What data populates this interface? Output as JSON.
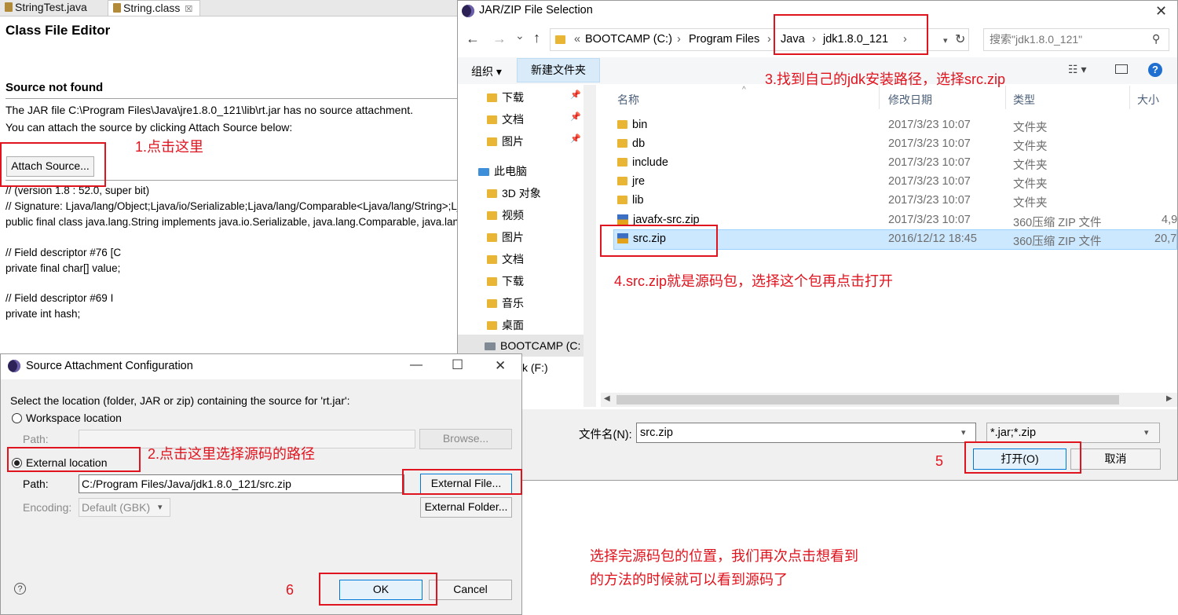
{
  "editor": {
    "tabs": [
      {
        "label": "StringTest.java"
      },
      {
        "label": "String.class",
        "close": "☒"
      }
    ],
    "title": "Class File Editor",
    "source_header": "Source not found",
    "line1": "The JAR file C:\\Program Files\\Java\\jre1.8.0_121\\lib\\rt.jar has no source attachment.",
    "line2": "You can attach the source by clicking Attach Source below:",
    "attach_button": "Attach Source...",
    "code": [
      "//  (version 1.8 : 52.0, super bit)",
      "// Signature: Ljava/lang/Object;Ljava/io/Serializable;Ljava/lang/Comparable<Ljava/lang/String>;Ljava/lang/CharSequence;",
      "public final class java.lang.String implements java.io.Serializable, java.lang.Comparable, java.lang.CharSequence {",
      "",
      "  // Field descriptor #76 [C",
      "  private final char[] value;",
      "",
      "  // Field descriptor #69 I",
      "  private int hash;"
    ]
  },
  "sac": {
    "title": "Source Attachment Configuration",
    "minimize": "—",
    "maximize": "☐",
    "close": "✕",
    "prompt": "Select the location (folder, JAR or zip) containing the source for 'rt.jar':",
    "workspace_label": "Workspace location",
    "path_label": "Path:",
    "browse_button": "Browse...",
    "external_label": "External location",
    "path_value": "C:/Program Files/Java/jdk1.8.0_121/src.zip",
    "external_file_button": "External File...",
    "encoding_label": "Encoding:",
    "encoding_value": "Default (GBK)",
    "external_folder_button": "External Folder...",
    "help": "?",
    "ok_button": "OK",
    "cancel_button": "Cancel"
  },
  "jar": {
    "title": "JAR/ZIP File Selection",
    "close": "✕",
    "back": "←",
    "forward": "→",
    "recent": "⌄",
    "up": "↑",
    "breadcrumb": [
      "«",
      "BOOTCAMP (C:)",
      "›",
      "Program Files",
      "›",
      "Java",
      "›",
      "jdk1.8.0_121",
      "›"
    ],
    "refresh": "↻",
    "search_placeholder": "搜索\"jdk1.8.0_121\"",
    "organize": "组织 ▾",
    "new_folder": "新建文件夹",
    "nav": [
      {
        "label": "下载",
        "kind": "folder",
        "pin": "📌"
      },
      {
        "label": "文档",
        "kind": "folder",
        "pin": "📌"
      },
      {
        "label": "图片",
        "kind": "folder",
        "pin": "📌"
      },
      {
        "label": "此电脑",
        "kind": "pc"
      },
      {
        "label": "3D 对象",
        "kind": "folder"
      },
      {
        "label": "视频",
        "kind": "folder"
      },
      {
        "label": "图片",
        "kind": "folder"
      },
      {
        "label": "文档",
        "kind": "folder"
      },
      {
        "label": "下载",
        "kind": "folder"
      },
      {
        "label": "音乐",
        "kind": "folder"
      },
      {
        "label": "桌面",
        "kind": "folder"
      },
      {
        "label": "BOOTCAMP (C:",
        "kind": "drive"
      },
      {
        "label": "k (F:)",
        "kind": "none"
      }
    ],
    "columns": {
      "name": "名称",
      "date": "修改日期",
      "type": "类型",
      "size": "大小"
    },
    "files": [
      {
        "name": "bin",
        "date": "2017/3/23 10:07",
        "type": "文件夹",
        "size": "",
        "kind": "folder"
      },
      {
        "name": "db",
        "date": "2017/3/23 10:07",
        "type": "文件夹",
        "size": "",
        "kind": "folder"
      },
      {
        "name": "include",
        "date": "2017/3/23 10:07",
        "type": "文件夹",
        "size": "",
        "kind": "folder"
      },
      {
        "name": "jre",
        "date": "2017/3/23 10:07",
        "type": "文件夹",
        "size": "",
        "kind": "folder"
      },
      {
        "name": "lib",
        "date": "2017/3/23 10:07",
        "type": "文件夹",
        "size": "",
        "kind": "folder"
      },
      {
        "name": "javafx-src.zip",
        "date": "2017/3/23 10:07",
        "type": "360压缩 ZIP 文件",
        "size": "4,9",
        "kind": "zip"
      },
      {
        "name": "src.zip",
        "date": "2016/12/12 18:45",
        "type": "360压缩 ZIP 文件",
        "size": "20,7",
        "kind": "zip",
        "selected": true
      }
    ],
    "filename_label": "文件名(N):",
    "filename_value": "src.zip",
    "filter_value": "*.jar;*.zip",
    "open_button": "打开(O)",
    "cancel_button": "取消"
  },
  "annotations": {
    "a1": "1.点击这里",
    "a2": "2.点击这里选择源码的路径",
    "a3": "3.找到自己的jdk安装路径，选择src.zip",
    "a4": "4.src.zip就是源码包，选择这个包再点击打开",
    "a5": "5",
    "a6": "6",
    "note_line1": "选择完源码包的位置，我们再次点击想看到",
    "note_line2": "的方法的时候就可以看到源码了"
  },
  "colors": {
    "annotation_red": "#e0141e",
    "selection": "#cce8ff"
  }
}
